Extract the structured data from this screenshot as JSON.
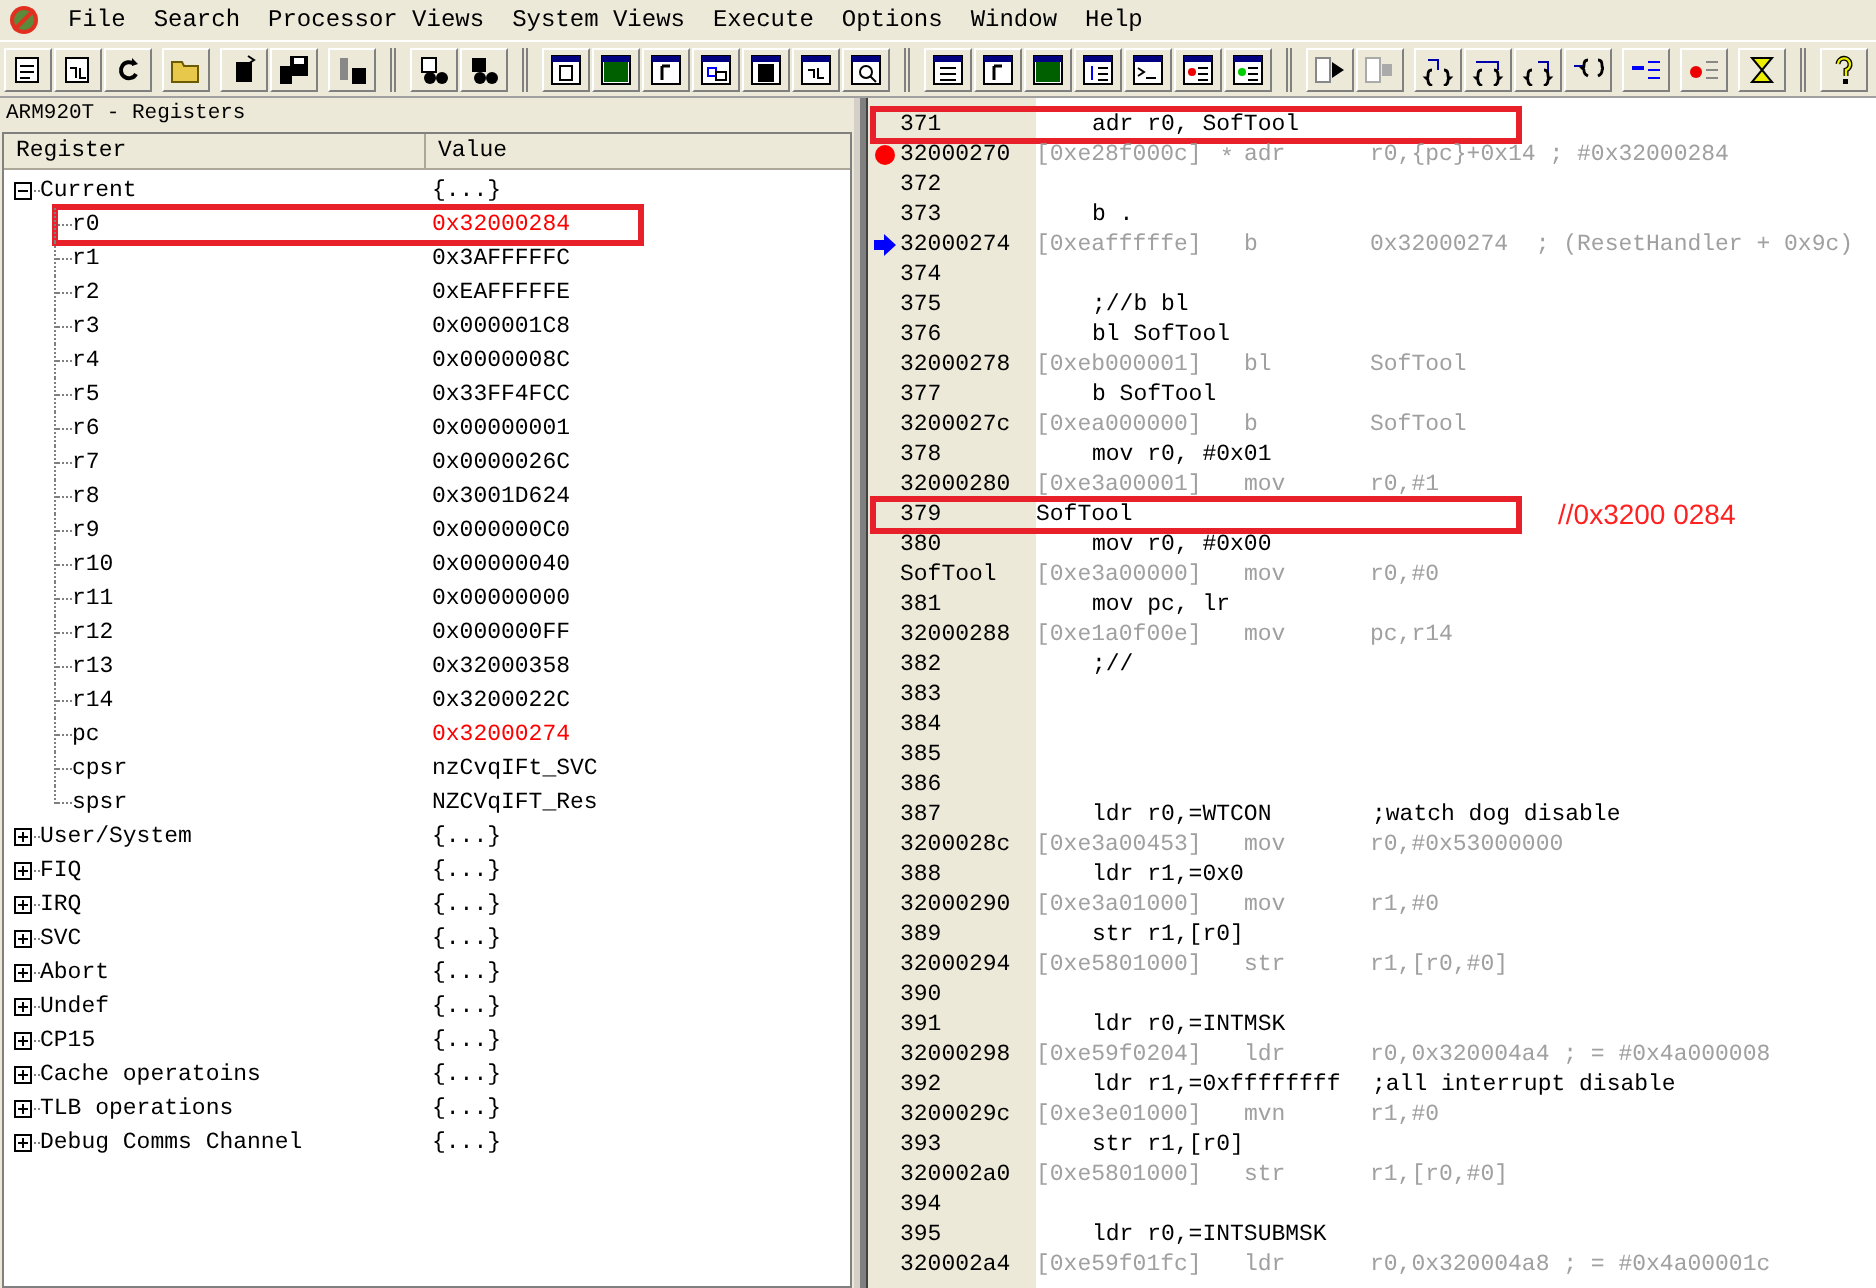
{
  "menu": [
    "File",
    "Search",
    "Processor Views",
    "System Views",
    "Execute",
    "Options",
    "Window",
    "Help"
  ],
  "registers": {
    "title": "ARM920T - Registers",
    "columns": [
      "Register",
      "Value"
    ],
    "groups": [
      {
        "name": "Current",
        "value": "{...}",
        "expanded": true,
        "children": [
          {
            "name": "r0",
            "value": "0x32000284",
            "changed": true,
            "highlighted": true
          },
          {
            "name": "r1",
            "value": "0x3AFFFFFC",
            "changed": false,
            "highlighted": false
          },
          {
            "name": "r2",
            "value": "0xEAFFFFFE",
            "changed": false,
            "highlighted": false
          },
          {
            "name": "r3",
            "value": "0x000001C8",
            "changed": false,
            "highlighted": false
          },
          {
            "name": "r4",
            "value": "0x0000008C",
            "changed": false,
            "highlighted": false
          },
          {
            "name": "r5",
            "value": "0x33FF4FCC",
            "changed": false,
            "highlighted": false
          },
          {
            "name": "r6",
            "value": "0x00000001",
            "changed": false,
            "highlighted": false
          },
          {
            "name": "r7",
            "value": "0x0000026C",
            "changed": false,
            "highlighted": false
          },
          {
            "name": "r8",
            "value": "0x3001D624",
            "changed": false,
            "highlighted": false
          },
          {
            "name": "r9",
            "value": "0x000000C0",
            "changed": false,
            "highlighted": false
          },
          {
            "name": "r10",
            "value": "0x00000040",
            "changed": false,
            "highlighted": false
          },
          {
            "name": "r11",
            "value": "0x00000000",
            "changed": false,
            "highlighted": false
          },
          {
            "name": "r12",
            "value": "0x000000FF",
            "changed": false,
            "highlighted": false
          },
          {
            "name": "r13",
            "value": "0x32000358",
            "changed": false,
            "highlighted": false
          },
          {
            "name": "r14",
            "value": "0x3200022C",
            "changed": false,
            "highlighted": false
          },
          {
            "name": "pc",
            "value": "0x32000274",
            "changed": true,
            "highlighted": false
          },
          {
            "name": "cpsr",
            "value": "nzCvqIFt_SVC",
            "changed": false,
            "highlighted": false
          },
          {
            "name": "spsr",
            "value": "NZCVqIFT_Res",
            "changed": false,
            "highlighted": false
          }
        ]
      },
      {
        "name": "User/System",
        "value": "{...}",
        "expanded": false
      },
      {
        "name": "FIQ",
        "value": "{...}",
        "expanded": false
      },
      {
        "name": "IRQ",
        "value": "{...}",
        "expanded": false
      },
      {
        "name": "SVC",
        "value": "{...}",
        "expanded": false
      },
      {
        "name": "Abort",
        "value": "{...}",
        "expanded": false
      },
      {
        "name": "Undef",
        "value": "{...}",
        "expanded": false
      },
      {
        "name": "CP15",
        "value": "{...}",
        "expanded": false
      },
      {
        "name": "Cache operatoins",
        "value": "{...}",
        "expanded": false
      },
      {
        "name": "TLB operations",
        "value": "{...}",
        "expanded": false
      },
      {
        "name": "Debug Comms Channel",
        "value": "{...}",
        "expanded": false
      }
    ]
  },
  "code_lines": [
    {
      "kind": "source",
      "num": "371",
      "code": "adr r0, SofTool",
      "highlighted": true
    },
    {
      "kind": "disasm",
      "addr": "32000270",
      "encoding": "[0xe28f000c]",
      "flag": "*",
      "mnemonic": "adr",
      "operands": "r0,{pc}+0x14 ; #0x32000284",
      "breakpoint": true,
      "current": false
    },
    {
      "kind": "source",
      "num": "372",
      "highlighted": false
    },
    {
      "kind": "source",
      "num": "373",
      "code": "b .",
      "highlighted": false
    },
    {
      "kind": "disasm",
      "addr": "32000274",
      "encoding": "[0xeafffffe]",
      "mnemonic": "b",
      "operands": "0x32000274  ; (ResetHandler + 0x9c)",
      "breakpoint": false,
      "current": true
    },
    {
      "kind": "source",
      "num": "374",
      "highlighted": false
    },
    {
      "kind": "source",
      "num": "375",
      "code": ";//b bl",
      "highlighted": false
    },
    {
      "kind": "source",
      "num": "376",
      "code": "bl SofTool",
      "highlighted": false
    },
    {
      "kind": "disasm",
      "addr": "32000278",
      "encoding": "[0xeb000001]",
      "mnemonic": "bl",
      "operands": "SofTool",
      "breakpoint": false,
      "current": false
    },
    {
      "kind": "source",
      "num": "377",
      "code": "b SofTool",
      "highlighted": false
    },
    {
      "kind": "disasm",
      "addr": "3200027c",
      "encoding": "[0xea000000]",
      "mnemonic": "b",
      "operands": "SofTool",
      "breakpoint": false,
      "current": false
    },
    {
      "kind": "source",
      "num": "378",
      "code": "mov r0, #0x01",
      "highlighted": false
    },
    {
      "kind": "disasm",
      "addr": "32000280",
      "encoding": "[0xe3a00001]",
      "mnemonic": "mov",
      "operands": "r0,#1",
      "breakpoint": false,
      "current": false
    },
    {
      "kind": "source",
      "num": "379",
      "label": "SofTool",
      "highlighted": true,
      "annotation": "//0x3200 0284"
    },
    {
      "kind": "source",
      "num": "380",
      "code": "mov r0, #0x00",
      "highlighted": false
    },
    {
      "kind": "disasm",
      "addr": "SofTool",
      "encoding": "[0xe3a00000]",
      "mnemonic": "mov",
      "operands": "r0,#0",
      "breakpoint": false,
      "current": false
    },
    {
      "kind": "source",
      "num": "381",
      "code": "mov pc, lr",
      "highlighted": false
    },
    {
      "kind": "disasm",
      "addr": "32000288",
      "encoding": "[0xe1a0f00e]",
      "mnemonic": "mov",
      "operands": "pc,r14",
      "breakpoint": false,
      "current": false
    },
    {
      "kind": "source",
      "num": "382",
      "code": ";//",
      "highlighted": false
    },
    {
      "kind": "source",
      "num": "383",
      "highlighted": false
    },
    {
      "kind": "source",
      "num": "384",
      "highlighted": false
    },
    {
      "kind": "source",
      "num": "385",
      "highlighted": false
    },
    {
      "kind": "source",
      "num": "386",
      "highlighted": false
    },
    {
      "kind": "source",
      "num": "387",
      "code": "ldr r0,=WTCON",
      "comment": ";watch dog disable",
      "highlighted": false
    },
    {
      "kind": "disasm",
      "addr": "3200028c",
      "encoding": "[0xe3a00453]",
      "mnemonic": "mov",
      "operands": "r0,#0x53000000",
      "breakpoint": false,
      "current": false
    },
    {
      "kind": "source",
      "num": "388",
      "code": "ldr r1,=0x0",
      "highlighted": false
    },
    {
      "kind": "disasm",
      "addr": "32000290",
      "encoding": "[0xe3a01000]",
      "mnemonic": "mov",
      "operands": "r1,#0",
      "breakpoint": false,
      "current": false
    },
    {
      "kind": "source",
      "num": "389",
      "code": "str r1,[r0]",
      "highlighted": false
    },
    {
      "kind": "disasm",
      "addr": "32000294",
      "encoding": "[0xe5801000]",
      "mnemonic": "str",
      "operands": "r1,[r0,#0]",
      "breakpoint": false,
      "current": false
    },
    {
      "kind": "source",
      "num": "390",
      "highlighted": false
    },
    {
      "kind": "source",
      "num": "391",
      "code": "ldr r0,=INTMSK",
      "highlighted": false
    },
    {
      "kind": "disasm",
      "addr": "32000298",
      "encoding": "[0xe59f0204]",
      "mnemonic": "ldr",
      "operands": "r0,0x320004a4 ; = #0x4a000008",
      "breakpoint": false,
      "current": false
    },
    {
      "kind": "source",
      "num": "392",
      "code": "ldr r1,=0xffffffff",
      "comment": ";all interrupt disable",
      "highlighted": false
    },
    {
      "kind": "disasm",
      "addr": "3200029c",
      "encoding": "[0xe3e01000]",
      "mnemonic": "mvn",
      "operands": "r1,#0",
      "breakpoint": false,
      "current": false
    },
    {
      "kind": "source",
      "num": "393",
      "code": "str r1,[r0]",
      "highlighted": false
    },
    {
      "kind": "disasm",
      "addr": "320002a0",
      "encoding": "[0xe5801000]",
      "mnemonic": "str",
      "operands": "r1,[r0,#0]",
      "breakpoint": false,
      "current": false
    },
    {
      "kind": "source",
      "num": "394",
      "highlighted": false
    },
    {
      "kind": "source",
      "num": "395",
      "code": "ldr r0,=INTSUBMSK",
      "highlighted": false
    },
    {
      "kind": "disasm",
      "addr": "320002a4",
      "encoding": "[0xe59f01fc]",
      "mnemonic": "ldr",
      "operands": "r0,0x320004a8 ; = #0x4a00001c",
      "breakpoint": false,
      "current": false
    }
  ]
}
